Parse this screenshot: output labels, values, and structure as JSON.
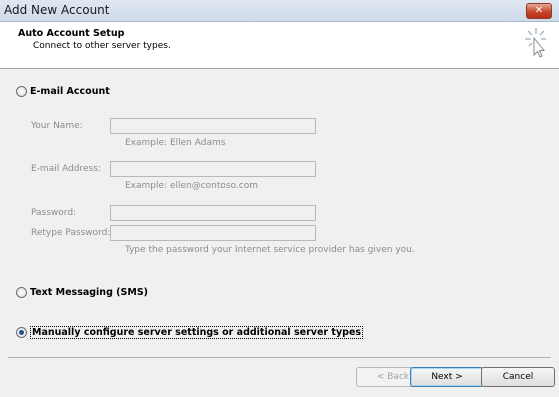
{
  "window": {
    "title": "Add New Account",
    "close_glyph": "✕"
  },
  "header": {
    "title": "Auto Account Setup",
    "subtitle": "Connect to other server types."
  },
  "email_account": {
    "label": "E-mail Account",
    "your_name_label": "Your Name:",
    "your_name_value": "",
    "your_name_hint": "Example: Ellen Adams",
    "email_label": "E-mail Address:",
    "email_value": "",
    "email_hint": "Example: ellen@contoso.com",
    "password_label": "Password:",
    "retype_label": "Retype Password:",
    "password_hint": "Type the password your Internet service provider has given you."
  },
  "text_messaging": {
    "label": "Text Messaging (SMS)"
  },
  "manual": {
    "label": "Manually configure server settings or additional server types",
    "selected": true
  },
  "buttons": {
    "back": "< Back",
    "next": "Next >",
    "cancel": "Cancel"
  }
}
